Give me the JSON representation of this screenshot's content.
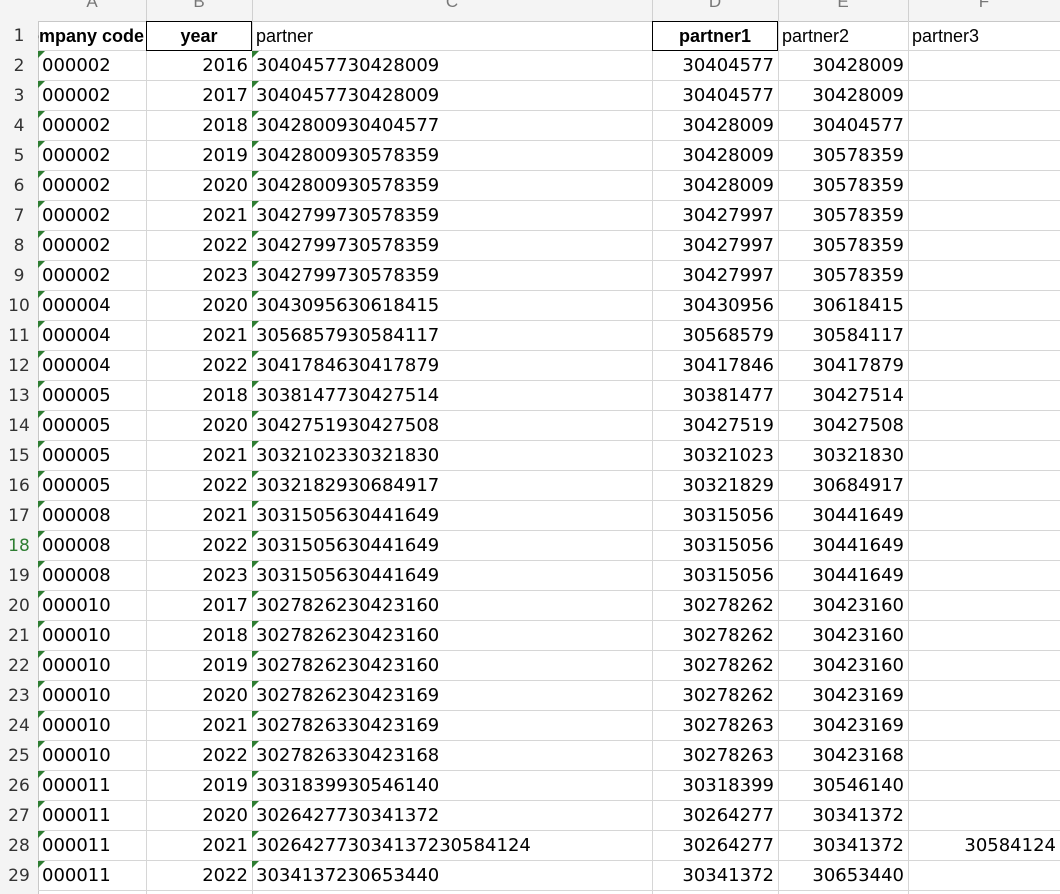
{
  "column_letters": [
    "A",
    "B",
    "C",
    "D",
    "E",
    "F"
  ],
  "header": {
    "company": "company code",
    "year": "year",
    "partner": "partner",
    "partner1": "partner1",
    "partner2": "partner2",
    "partner3": "partner3"
  },
  "active_row": 18,
  "accent_color": "#2e7d32",
  "rows": [
    {
      "company": "000002",
      "year": "2016",
      "partner": "3040457730428009",
      "p1": "30404577",
      "p2": "30428009",
      "p3": ""
    },
    {
      "company": "000002",
      "year": "2017",
      "partner": "3040457730428009",
      "p1": "30404577",
      "p2": "30428009",
      "p3": ""
    },
    {
      "company": "000002",
      "year": "2018",
      "partner": "3042800930404577",
      "p1": "30428009",
      "p2": "30404577",
      "p3": ""
    },
    {
      "company": "000002",
      "year": "2019",
      "partner": "3042800930578359",
      "p1": "30428009",
      "p2": "30578359",
      "p3": ""
    },
    {
      "company": "000002",
      "year": "2020",
      "partner": "3042800930578359",
      "p1": "30428009",
      "p2": "30578359",
      "p3": ""
    },
    {
      "company": "000002",
      "year": "2021",
      "partner": "3042799730578359",
      "p1": "30427997",
      "p2": "30578359",
      "p3": ""
    },
    {
      "company": "000002",
      "year": "2022",
      "partner": "3042799730578359",
      "p1": "30427997",
      "p2": "30578359",
      "p3": ""
    },
    {
      "company": "000002",
      "year": "2023",
      "partner": "3042799730578359",
      "p1": "30427997",
      "p2": "30578359",
      "p3": ""
    },
    {
      "company": "000004",
      "year": "2020",
      "partner": "3043095630618415",
      "p1": "30430956",
      "p2": "30618415",
      "p3": ""
    },
    {
      "company": "000004",
      "year": "2021",
      "partner": "3056857930584117",
      "p1": "30568579",
      "p2": "30584117",
      "p3": ""
    },
    {
      "company": "000004",
      "year": "2022",
      "partner": "3041784630417879",
      "p1": "30417846",
      "p2": "30417879",
      "p3": ""
    },
    {
      "company": "000005",
      "year": "2018",
      "partner": "3038147730427514",
      "p1": "30381477",
      "p2": "30427514",
      "p3": ""
    },
    {
      "company": "000005",
      "year": "2020",
      "partner": "3042751930427508",
      "p1": "30427519",
      "p2": "30427508",
      "p3": ""
    },
    {
      "company": "000005",
      "year": "2021",
      "partner": "3032102330321830",
      "p1": "30321023",
      "p2": "30321830",
      "p3": ""
    },
    {
      "company": "000005",
      "year": "2022",
      "partner": "3032182930684917",
      "p1": "30321829",
      "p2": "30684917",
      "p3": ""
    },
    {
      "company": "000008",
      "year": "2021",
      "partner": "3031505630441649",
      "p1": "30315056",
      "p2": "30441649",
      "p3": ""
    },
    {
      "company": "000008",
      "year": "2022",
      "partner": "3031505630441649",
      "p1": "30315056",
      "p2": "30441649",
      "p3": ""
    },
    {
      "company": "000008",
      "year": "2023",
      "partner": "3031505630441649",
      "p1": "30315056",
      "p2": "30441649",
      "p3": ""
    },
    {
      "company": "000010",
      "year": "2017",
      "partner": "3027826230423160",
      "p1": "30278262",
      "p2": "30423160",
      "p3": ""
    },
    {
      "company": "000010",
      "year": "2018",
      "partner": "3027826230423160",
      "p1": "30278262",
      "p2": "30423160",
      "p3": ""
    },
    {
      "company": "000010",
      "year": "2019",
      "partner": "3027826230423160",
      "p1": "30278262",
      "p2": "30423160",
      "p3": ""
    },
    {
      "company": "000010",
      "year": "2020",
      "partner": "3027826230423169",
      "p1": "30278262",
      "p2": "30423169",
      "p3": ""
    },
    {
      "company": "000010",
      "year": "2021",
      "partner": "3027826330423169",
      "p1": "30278263",
      "p2": "30423169",
      "p3": ""
    },
    {
      "company": "000010",
      "year": "2022",
      "partner": "3027826330423168",
      "p1": "30278263",
      "p2": "30423168",
      "p3": ""
    },
    {
      "company": "000011",
      "year": "2019",
      "partner": "3031839930546140",
      "p1": "30318399",
      "p2": "30546140",
      "p3": ""
    },
    {
      "company": "000011",
      "year": "2020",
      "partner": "3026427730341372",
      "p1": "30264277",
      "p2": "30341372",
      "p3": ""
    },
    {
      "company": "000011",
      "year": "2021",
      "partner": "302642773034137230584124",
      "p1": "30264277",
      "p2": "30341372",
      "p3": "30584124"
    },
    {
      "company": "000011",
      "year": "2022",
      "partner": "3034137230653440",
      "p1": "30341372",
      "p2": "30653440",
      "p3": ""
    }
  ]
}
